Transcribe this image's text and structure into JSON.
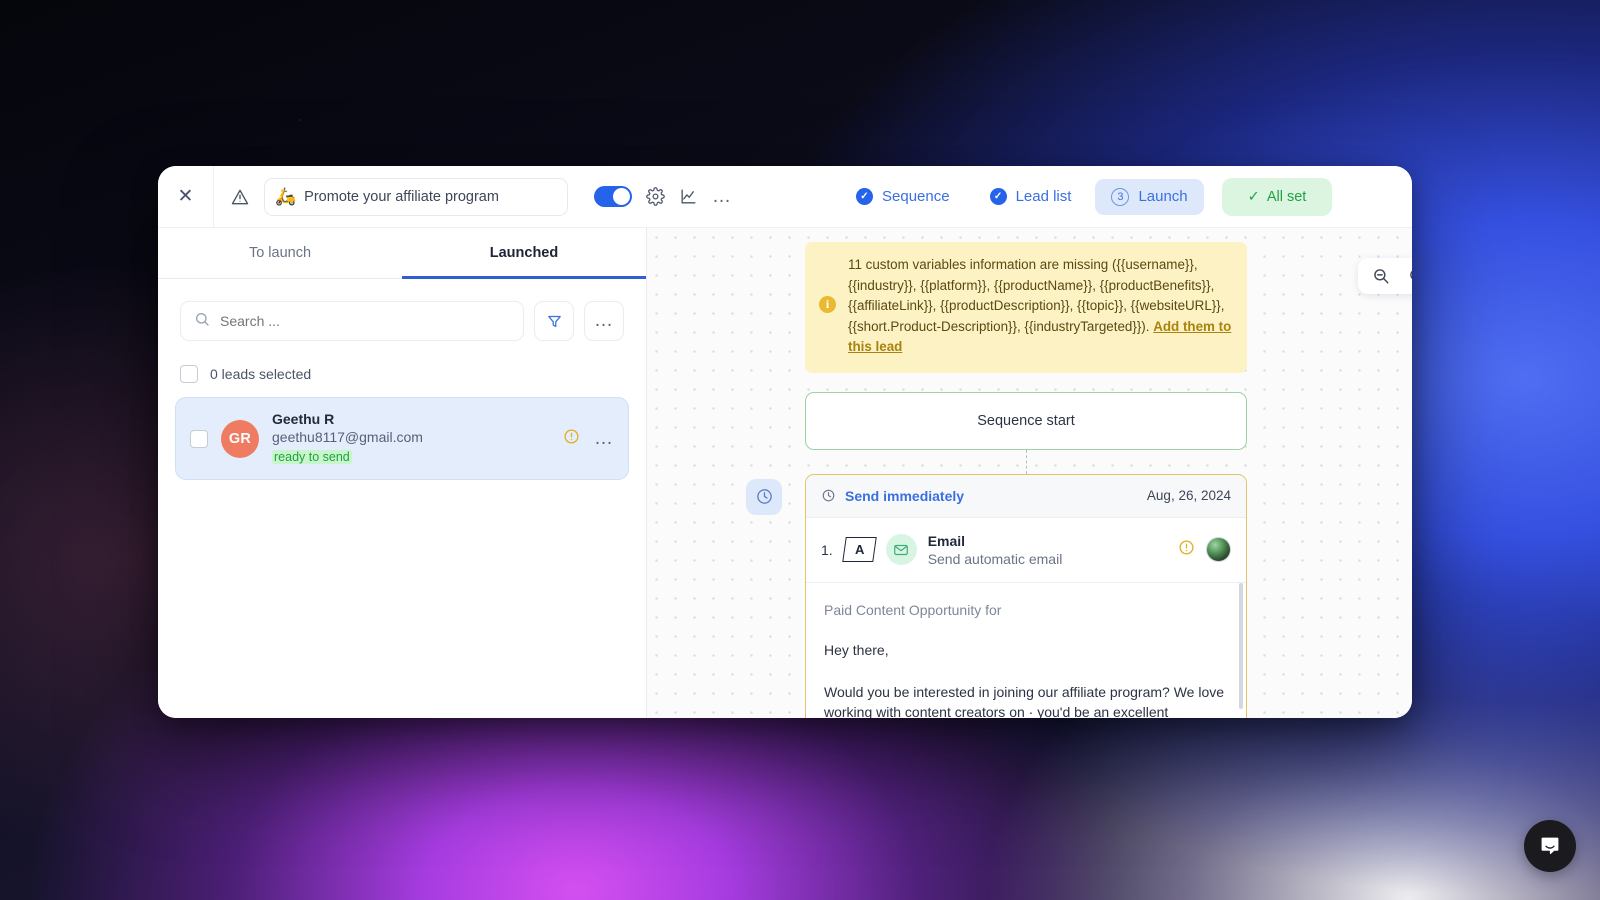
{
  "topbar": {
    "close_label": "✕",
    "warning_icon": "warning-triangle-icon",
    "campaign_emoji": "🛵",
    "campaign_name": "Promote your affiliate program",
    "toggle_state": "on",
    "settings_icon": "gear-icon",
    "analytics_icon": "chart-line-icon",
    "more_icon": "…"
  },
  "steps": [
    {
      "label": "Sequence",
      "state": "complete",
      "marker": "✓"
    },
    {
      "label": "Lead list",
      "state": "complete",
      "marker": "✓"
    },
    {
      "label": "Launch",
      "state": "active",
      "marker": "3"
    }
  ],
  "all_set": {
    "label": "All set",
    "check": "✓",
    "color": "#22a047",
    "bg": "#dcf5e1"
  },
  "left_panel": {
    "tabs": [
      {
        "label": "To launch",
        "active": false
      },
      {
        "label": "Launched",
        "active": true
      }
    ],
    "search": {
      "placeholder": "Search ...",
      "value": "",
      "icon": "search-icon"
    },
    "filter_icon": "filter-funnel-icon",
    "more_icon": "…",
    "select_label": "0 leads selected",
    "leads": [
      {
        "initials": "GR",
        "avatar_color": "#ef7b63",
        "name": "Geethu R",
        "email": "geethu8117@gmail.com",
        "status": "ready to send",
        "status_color": "#1ea33f",
        "warning_icon": "alert-circle-icon",
        "more_icon": "…",
        "selected": true
      }
    ]
  },
  "canvas": {
    "zoom_out_icon": "zoom-out-icon",
    "zoom_in_icon": "zoom-in-icon",
    "warning": {
      "icon": "info-circle-icon",
      "text": "11 custom variables information are missing ({{username}}, {{industry}}, {{platform}}, {{productName}}, {{productBenefits}}, {{affiliateLink}}, {{productDescription}}, {{topic}}, {{websiteURL}}, {{short.Product-Description}}, {{industryTargeted}}). ",
      "link": "Add them to this lead"
    },
    "sequence_start": "Sequence start",
    "clock_badge_icon": "clock-icon",
    "step": {
      "timing_icon": "clock-icon",
      "timing_label": "Send immediately",
      "date": "Aug, 26, 2024",
      "index": "1.",
      "variant": "A",
      "channel_icon": "envelope-icon",
      "title": "Email",
      "subtitle": "Send automatic email",
      "warning_icon": "alert-circle-icon",
      "avatar": "user-avatar"
    },
    "email": {
      "subject": "Paid Content Opportunity for",
      "paragraphs": [
        "Hey there,",
        "Would you be interested in joining our affiliate program? We love working with content creators on · you'd be an excellent"
      ]
    }
  },
  "intercom": {
    "icon": "chat-bubble-icon"
  }
}
